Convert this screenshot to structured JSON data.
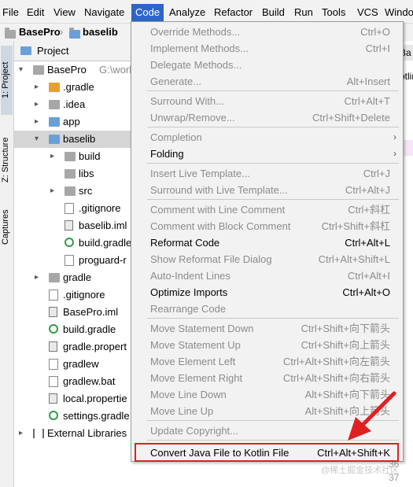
{
  "menubar": {
    "items": [
      "File",
      "Edit",
      "View",
      "Navigate",
      "Code",
      "Analyze",
      "Refactor",
      "Build",
      "Run",
      "Tools",
      "VCS",
      "Windo"
    ]
  },
  "breadcrumb": {
    "items": [
      "BasePro",
      "baselib"
    ]
  },
  "leftstrip": {
    "project": "1: Project",
    "structure": "Z: Structure",
    "captures": "Captures"
  },
  "panel": {
    "title": "Project",
    "root_label": "BasePro",
    "root_path": "G:\\work",
    "tree": [
      {
        "label": "BasePro",
        "extra": "G:\\work",
        "level": 0,
        "arrow": "▾",
        "icon": "folder-gray"
      },
      {
        "label": ".gradle",
        "level": 1,
        "arrow": "▸",
        "icon": "folder-orange"
      },
      {
        "label": ".idea",
        "level": 1,
        "arrow": "▸",
        "icon": "folder-gray"
      },
      {
        "label": "app",
        "level": 1,
        "arrow": "▸",
        "icon": "folder-blue"
      },
      {
        "label": "baselib",
        "level": 1,
        "arrow": "▾",
        "icon": "folder-blue"
      },
      {
        "label": "build",
        "level": 2,
        "arrow": "▸",
        "icon": "folder-gray"
      },
      {
        "label": "libs",
        "level": 2,
        "arrow": "",
        "icon": "folder-gray"
      },
      {
        "label": "src",
        "level": 2,
        "arrow": "▸",
        "icon": "folder-gray"
      },
      {
        "label": ".gitignore",
        "level": 2,
        "arrow": "",
        "icon": "file"
      },
      {
        "label": "baselib.iml",
        "level": 2,
        "arrow": "",
        "icon": "doc"
      },
      {
        "label": "build.gradle",
        "level": 2,
        "arrow": "",
        "icon": "gradle"
      },
      {
        "label": "proguard-r",
        "level": 2,
        "arrow": "",
        "icon": "file"
      },
      {
        "label": "gradle",
        "level": 1,
        "arrow": "▸",
        "icon": "folder-gray"
      },
      {
        "label": ".gitignore",
        "level": 1,
        "arrow": "",
        "icon": "file"
      },
      {
        "label": "BasePro.iml",
        "level": 1,
        "arrow": "",
        "icon": "doc"
      },
      {
        "label": "build.gradle",
        "level": 1,
        "arrow": "",
        "icon": "gradle"
      },
      {
        "label": "gradle.propert",
        "level": 1,
        "arrow": "",
        "icon": "doc"
      },
      {
        "label": "gradlew",
        "level": 1,
        "arrow": "",
        "icon": "file"
      },
      {
        "label": "gradlew.bat",
        "level": 1,
        "arrow": "",
        "icon": "file"
      },
      {
        "label": "local.propertie",
        "level": 1,
        "arrow": "",
        "icon": "doc"
      },
      {
        "label": "settings.gradle",
        "level": 1,
        "arrow": "",
        "icon": "gradle"
      },
      {
        "label": "External Libraries",
        "level": 0,
        "arrow": "▸",
        "icon": "libs"
      }
    ]
  },
  "code_menu": {
    "items": [
      {
        "label": "Override Methods...",
        "shortcut": "Ctrl+O",
        "disabled": true
      },
      {
        "label": "Implement Methods...",
        "shortcut": "Ctrl+I",
        "disabled": true
      },
      {
        "label": "Delegate Methods...",
        "shortcut": "",
        "disabled": true
      },
      {
        "label": "Generate...",
        "shortcut": "Alt+Insert",
        "disabled": true
      },
      {
        "sep": true
      },
      {
        "label": "Surround With...",
        "shortcut": "Ctrl+Alt+T",
        "disabled": true
      },
      {
        "label": "Unwrap/Remove...",
        "shortcut": "Ctrl+Shift+Delete",
        "disabled": true
      },
      {
        "sep": true
      },
      {
        "label": "Completion",
        "shortcut": "",
        "disabled": true,
        "submenu": true
      },
      {
        "label": "Folding",
        "shortcut": "",
        "disabled": false,
        "submenu": true
      },
      {
        "sep": true
      },
      {
        "label": "Insert Live Template...",
        "shortcut": "Ctrl+J",
        "disabled": true
      },
      {
        "label": "Surround with Live Template...",
        "shortcut": "Ctrl+Alt+J",
        "disabled": true
      },
      {
        "sep": true
      },
      {
        "label": "Comment with Line Comment",
        "shortcut": "Ctrl+斜杠",
        "disabled": true
      },
      {
        "label": "Comment with Block Comment",
        "shortcut": "Ctrl+Shift+斜杠",
        "disabled": true
      },
      {
        "label": "Reformat Code",
        "shortcut": "Ctrl+Alt+L",
        "disabled": false
      },
      {
        "label": "Show Reformat File Dialog",
        "shortcut": "Ctrl+Alt+Shift+L",
        "disabled": true
      },
      {
        "label": "Auto-Indent Lines",
        "shortcut": "Ctrl+Alt+I",
        "disabled": true
      },
      {
        "label": "Optimize Imports",
        "shortcut": "Ctrl+Alt+O",
        "disabled": false
      },
      {
        "label": "Rearrange Code",
        "shortcut": "",
        "disabled": true
      },
      {
        "sep": true
      },
      {
        "label": "Move Statement Down",
        "shortcut": "Ctrl+Shift+向下箭头",
        "disabled": true
      },
      {
        "label": "Move Statement Up",
        "shortcut": "Ctrl+Shift+向上箭头",
        "disabled": true
      },
      {
        "label": "Move Element Left",
        "shortcut": "Ctrl+Alt+Shift+向左箭头",
        "disabled": true
      },
      {
        "label": "Move Element Right",
        "shortcut": "Ctrl+Alt+Shift+向右箭头",
        "disabled": true
      },
      {
        "label": "Move Line Down",
        "shortcut": "Alt+Shift+向下箭头",
        "disabled": true
      },
      {
        "label": "Move Line Up",
        "shortcut": "Alt+Shift+向上箭头",
        "disabled": true
      },
      {
        "sep": true
      },
      {
        "label": "Update Copyright...",
        "shortcut": "",
        "disabled": true
      },
      {
        "sep": true
      },
      {
        "label": "Convert Java File to Kotlin File",
        "shortcut": "Ctrl+Alt+Shift+K",
        "disabled": false,
        "highlighted": true
      }
    ]
  },
  "editor": {
    "line_numbers": [
      "36",
      "37"
    ],
    "tab_fragment": "Ba",
    "code_fragment": "otlin"
  },
  "watermark": "@稀土掘金技术社区",
  "colors": {
    "menu_active": "#2f65ca",
    "highlight_box": "#e02020",
    "arrow": "#e02020"
  }
}
